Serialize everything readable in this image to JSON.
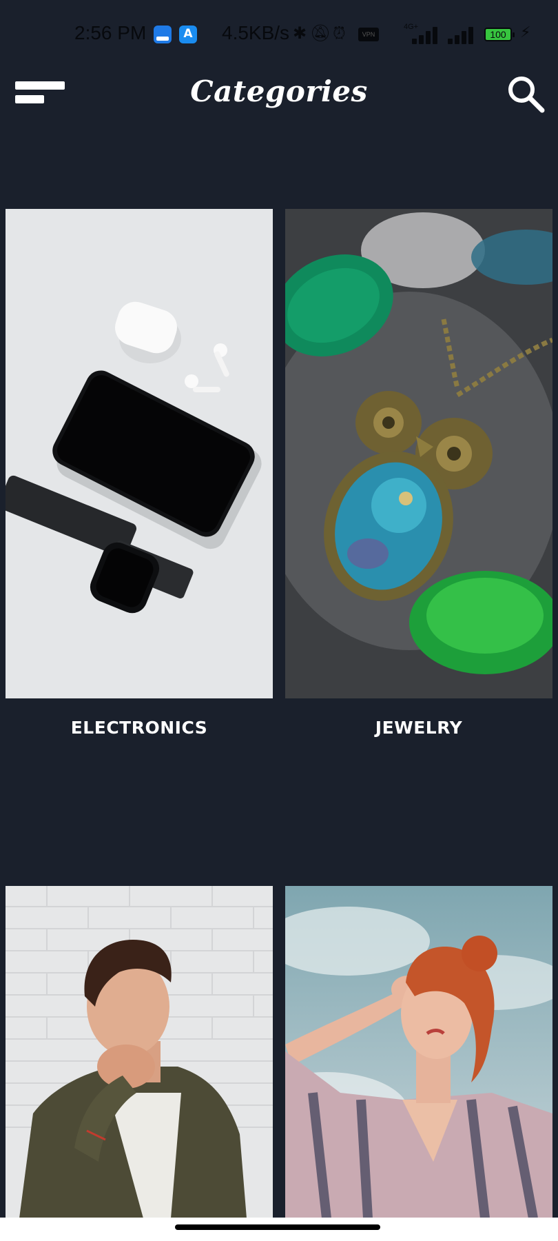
{
  "status_bar": {
    "time": "2:56 PM",
    "network_speed": "4.5KB/s",
    "vpn": "VPN",
    "network_type": "4G+",
    "battery": "100"
  },
  "header": {
    "title": "Categories",
    "menu_icon": "menu-icon",
    "search_icon": "search-icon"
  },
  "categories": [
    {
      "label": "ELECTRONICS",
      "image": "phone-earbuds-watch-photo"
    },
    {
      "label": "JEWELRY",
      "image": "owl-pendant-necklace-photo"
    },
    {
      "label": "",
      "image": "man-portrait-photo"
    },
    {
      "label": "",
      "image": "woman-portrait-photo"
    }
  ],
  "colors": {
    "background": "#1a202c",
    "text": "#ffffff",
    "battery_fill": "#37c53f"
  }
}
